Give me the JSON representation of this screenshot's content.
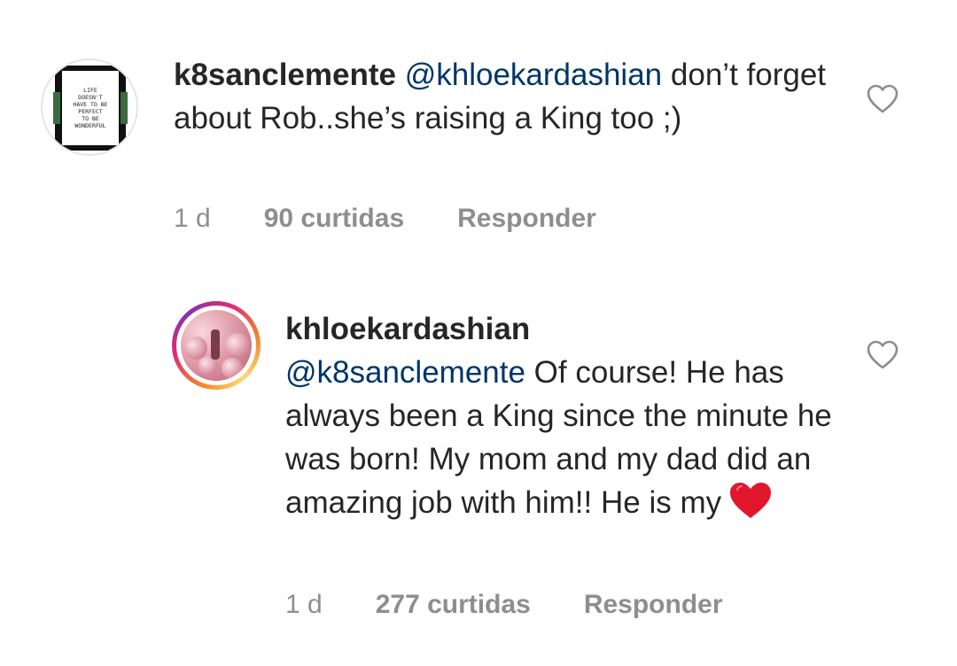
{
  "comments": [
    {
      "username": "k8sanclemente",
      "mention": "@khloekardashian",
      "text": "don’t forget about Rob..she’s raising a King too ;)",
      "time": "1 d",
      "likes": "90 curtidas",
      "reply_label": "Responder",
      "avatar_poster_lines": [
        "LIFE",
        "DOESN'T",
        "HAVE TO BE",
        "PERFECT",
        "TO BE",
        "WONDERFUL"
      ]
    },
    {
      "username": "khloekardashian",
      "mention": "@k8sanclemente",
      "text": " Of course! He has always been a King since the minute he was born! My mom and my dad did an amazing job with him!! He is my",
      "emoji": "red-heart",
      "time": "1 d",
      "likes": "277 curtidas",
      "reply_label": "Responder"
    }
  ],
  "icons": {
    "like": "heart-outline-icon",
    "emoji": "red-heart-icon"
  },
  "colors": {
    "text": "#262626",
    "mention": "#003569",
    "meta": "#8e8e8e",
    "heart_outline": "#8e8e8e",
    "heart_red": "#e0162b"
  }
}
